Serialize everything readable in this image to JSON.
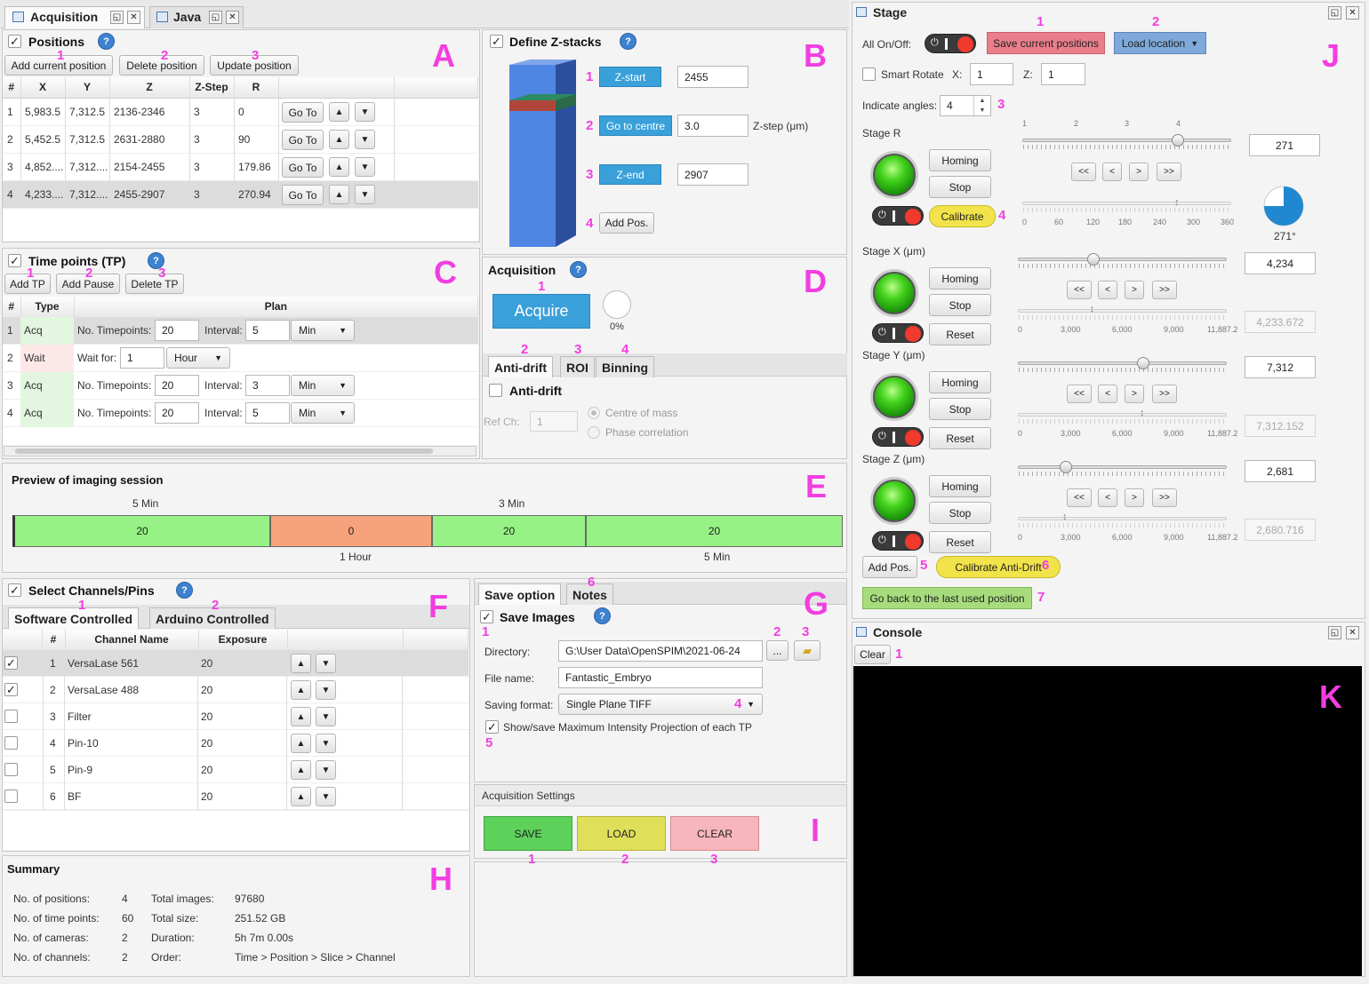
{
  "tabs": {
    "acquisition": "Acquisition",
    "java": "Java"
  },
  "positions": {
    "title": "Positions",
    "add": "Add current position",
    "delete": "Delete position",
    "update": "Update position",
    "cols": [
      "#",
      "X",
      "Y",
      "Z",
      "Z-Step",
      "R"
    ],
    "rows": [
      [
        "1",
        "5,983.5",
        "7,312.5",
        "2136-2346",
        "3",
        "0"
      ],
      [
        "2",
        "5,452.5",
        "7,312.5",
        "2631-2880",
        "3",
        "90"
      ],
      [
        "3",
        "4,852....",
        "7,312....",
        "2154-2455",
        "3",
        "179.86"
      ],
      [
        "4",
        "4,233....",
        "7,312....",
        "2455-2907",
        "3",
        "270.94"
      ]
    ],
    "goto": "Go To"
  },
  "zstack": {
    "title": "Define Z-stacks",
    "zstart": "Z-start",
    "zstart_val": "2455",
    "centre": "Go to centre",
    "zstep_val": "3.0",
    "zstep_label": "Z-step (μm)",
    "zend": "Z-end",
    "zend_val": "2907",
    "addpos": "Add Pos."
  },
  "timepoints": {
    "title": "Time points (TP)",
    "add": "Add TP",
    "pause": "Add Pause",
    "delete": "Delete TP",
    "cols": [
      "#",
      "Type",
      "Plan"
    ],
    "rows": [
      {
        "n": "1",
        "type": "Acq",
        "l1": "No. Timepoints:",
        "v1": "20",
        "l2": "Interval:",
        "v2": "5",
        "unit": "Min"
      },
      {
        "n": "2",
        "type": "Wait",
        "l1": "Wait for:",
        "v1": "1",
        "unit": "Hour"
      },
      {
        "n": "3",
        "type": "Acq",
        "l1": "No. Timepoints:",
        "v1": "20",
        "l2": "Interval:",
        "v2": "3",
        "unit": "Min"
      },
      {
        "n": "4",
        "type": "Acq",
        "l1": "No. Timepoints:",
        "v1": "20",
        "l2": "Interval:",
        "v2": "5",
        "unit": "Min"
      }
    ]
  },
  "acq": {
    "title": "Acquisition",
    "acquire": "Acquire",
    "progress": "0%",
    "tabs": [
      "Anti-drift",
      "ROI",
      "Binning"
    ],
    "antidrift": "Anti-drift",
    "refch": "Ref Ch:",
    "refch_val": "1",
    "centre": "Centre of mass",
    "phase": "Phase correlation"
  },
  "preview": {
    "title": "Preview of imaging session",
    "top1": "5 Min",
    "top2": "3 Min",
    "segs": [
      "20",
      "0",
      "20",
      "20"
    ],
    "bot1": "1 Hour",
    "bot2": "5 Min"
  },
  "channels": {
    "title": "Select Channels/Pins",
    "tab1": "Software Controlled",
    "tab2": "Arduino Controlled",
    "cols": [
      "#",
      "Channel Name",
      "Exposure"
    ],
    "rows": [
      [
        "1",
        "VersaLase 561",
        "20"
      ],
      [
        "2",
        "VersaLase 488",
        "20"
      ],
      [
        "3",
        "Filter",
        "20"
      ],
      [
        "4",
        "Pin-10",
        "20"
      ],
      [
        "5",
        "Pin-9",
        "20"
      ],
      [
        "6",
        "BF",
        "20"
      ]
    ]
  },
  "save": {
    "tab1": "Save option",
    "tab2": "Notes",
    "saveimg": "Save Images",
    "dir_l": "Directory:",
    "dir": "G:\\User Data\\OpenSPIM\\2021-06-24",
    "browse": "...",
    "file_l": "File name:",
    "file": "Fantastic_Embryo",
    "fmt_l": "Saving format:",
    "fmt": "Single Plane TIFF",
    "mip": "Show/save Maximum Intensity Projection of each TP"
  },
  "settings": {
    "title": "Acquisition Settings",
    "save": "SAVE",
    "load": "LOAD",
    "clear": "CLEAR"
  },
  "summary": {
    "title": "Summary",
    "l": [
      [
        "No. of positions:",
        "4",
        "Total images:",
        "97680"
      ],
      [
        "No. of time points:",
        "60",
        "Total size:",
        "251.52 GB"
      ],
      [
        "No. of cameras:",
        "2",
        "Duration:",
        "5h 7m 0.00s"
      ],
      [
        "No. of channels:",
        "2",
        "Order:",
        "Time > Position > Slice > Channel"
      ]
    ]
  },
  "stage": {
    "title": "Stage",
    "allonoff": "All On/Off:",
    "savepos": "Save current positions",
    "loadloc": "Load location",
    "smart": "Smart Rotate",
    "x": "X:",
    "xv": "1",
    "z": "Z:",
    "zv": "1",
    "indicate": "Indicate angles:",
    "indicate_v": "4",
    "r": {
      "label": "Stage R",
      "val": "271",
      "angle": "271°",
      "ticks": [
        "1",
        "2",
        "3",
        "4"
      ],
      "scale": [
        "0",
        "60",
        "120",
        "180",
        "240",
        "300",
        "360"
      ]
    },
    "x_axis": {
      "label": "Stage X (μm)",
      "val": "4,234",
      "ro": "4,233.672"
    },
    "y_axis": {
      "label": "Stage Y (μm)",
      "val": "7,312",
      "ro": "7,312.152"
    },
    "z_axis": {
      "label": "Stage Z (μm)",
      "val": "2,681",
      "ro": "2,680.716"
    },
    "scale": [
      "0",
      "3,000",
      "6,000",
      "9,000",
      "11,887.2"
    ],
    "homing": "Homing",
    "stop": "Stop",
    "calibrate": "Calibrate",
    "reset": "Reset",
    "addpos": "Add Pos.",
    "calad": "Calibrate Anti-Drift",
    "goback": "Go back to the last used position",
    "nav": [
      "<<",
      "<",
      ">",
      ">>"
    ]
  },
  "console": {
    "title": "Console",
    "clear": "Clear"
  },
  "letters": [
    "A",
    "B",
    "C",
    "D",
    "E",
    "F",
    "G",
    "H",
    "I",
    "J",
    "K"
  ]
}
